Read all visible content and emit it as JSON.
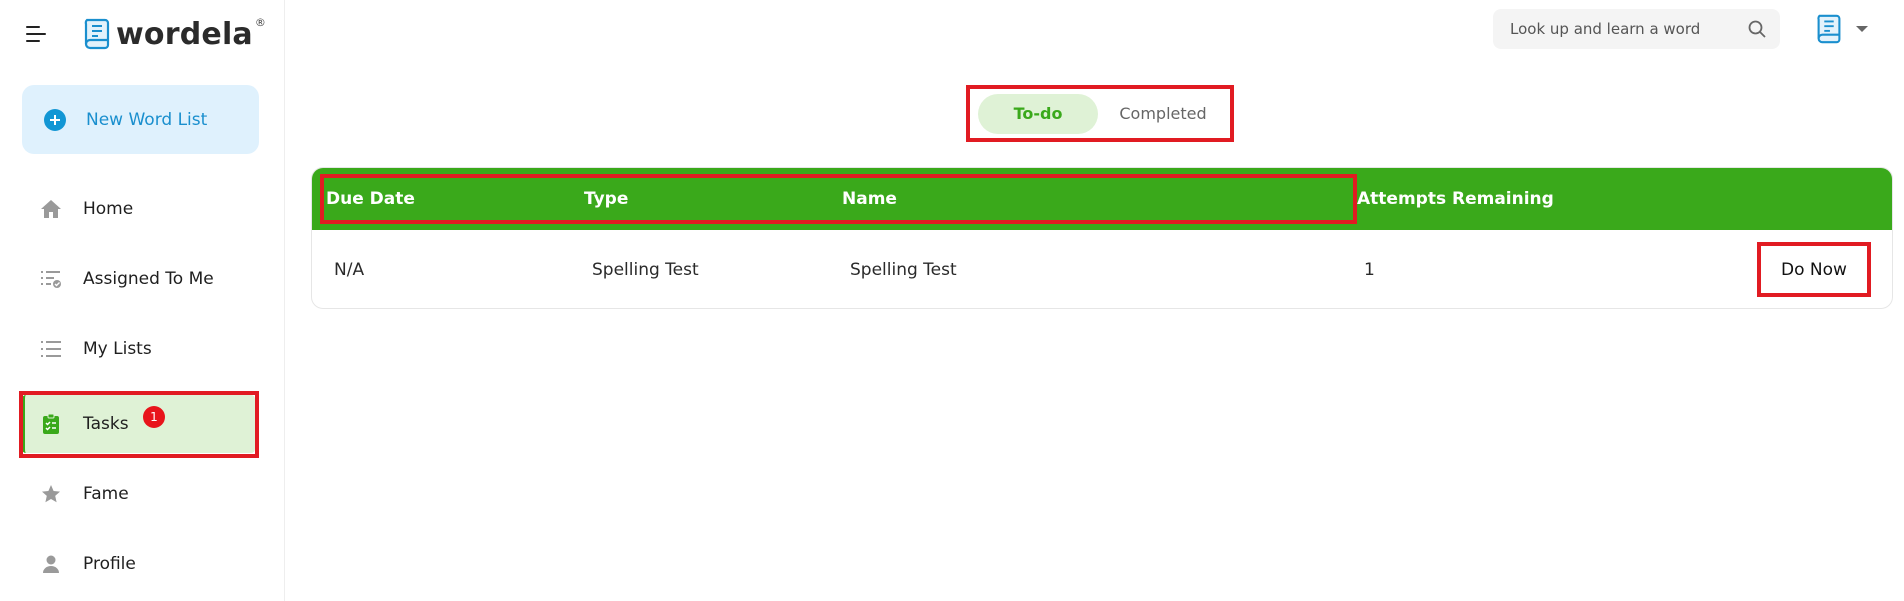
{
  "app": {
    "logo_text": "wordela",
    "logo_reg": "®",
    "brand_color": "#3aa91b",
    "accent_blue": "#1296d4",
    "highlight_color": "#e11b22"
  },
  "sidebar": {
    "new_list_label": "New Word List",
    "items": [
      {
        "label": "Home",
        "icon": "home-icon"
      },
      {
        "label": "Assigned To Me",
        "icon": "assigned-list-icon"
      },
      {
        "label": "My Lists",
        "icon": "list-icon"
      },
      {
        "label": "Tasks",
        "icon": "clipboard-check-icon",
        "badge": "1",
        "active": true
      },
      {
        "label": "Fame",
        "icon": "star-icon"
      },
      {
        "label": "Profile",
        "icon": "user-icon"
      }
    ]
  },
  "header": {
    "search_placeholder": "Look up and learn a word"
  },
  "tabs": [
    {
      "label": "To-do",
      "active": true
    },
    {
      "label": "Completed",
      "active": false
    }
  ],
  "table": {
    "columns": [
      "Due Date",
      "Type",
      "Name",
      "Attempts Remaining"
    ],
    "rows": [
      {
        "due_date": "N/A",
        "type": "Spelling Test",
        "name": "Spelling Test",
        "attempts": "1",
        "action": "Do Now"
      }
    ]
  }
}
